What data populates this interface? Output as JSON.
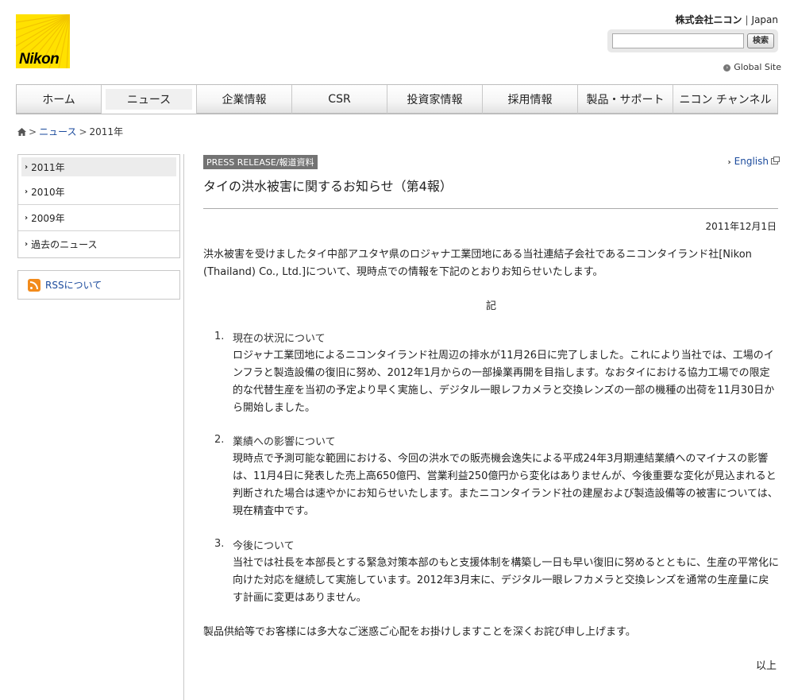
{
  "header": {
    "logo_text": "Nikon",
    "company": "株式会社ニコン",
    "region": "Japan",
    "search": {
      "placeholder": "",
      "button_label": "検索"
    },
    "global_site_label": "Global Site"
  },
  "nav": {
    "items": [
      {
        "label": "ホーム"
      },
      {
        "label": "ニュース"
      },
      {
        "label": "企業情報"
      },
      {
        "label": "CSR"
      },
      {
        "label": "投資家情報"
      },
      {
        "label": "採用情報"
      },
      {
        "label": "製品・サポート"
      },
      {
        "label": "ニコン チャンネル"
      }
    ],
    "active_index": 1
  },
  "breadcrumb": {
    "news": "ニュース",
    "current": "2011年"
  },
  "sidebar": {
    "items": [
      {
        "label": "2011年"
      },
      {
        "label": "2010年"
      },
      {
        "label": "2009年"
      },
      {
        "label": "過去のニュース"
      }
    ],
    "rss_label": "RSSについて"
  },
  "article": {
    "press_label": "PRESS RELEASE/報道資料",
    "english_link": "English",
    "title": "タイの洪水被害に関するお知らせ（第4報）",
    "date": "2011年12月1日",
    "intro": "洪水被害を受けましたタイ中部アユタヤ県のロジャナ工業団地にある当社連結子会社であるニコンタイランド社[Nikon (Thailand) Co., Ltd.]について、現時点での情報を下記のとおりお知らせいたします。",
    "ki": "記",
    "items": [
      {
        "num": "1.",
        "heading": "現在の状況について",
        "text": "ロジャナ工業団地によるニコンタイランド社周辺の排水が11月26日に完了しました。これにより当社では、工場のインフラと製造設備の復旧に努め、2012年1月からの一部操業再開を目指します。なおタイにおける協力工場での限定的な代替生産を当初の予定より早く実施し、デジタル一眼レフカメラと交換レンズの一部の機種の出荷を11月30日から開始しました。"
      },
      {
        "num": "2.",
        "heading": "業績への影響について",
        "text": "現時点で予測可能な範囲における、今回の洪水での販売機会逸失による平成24年3月期連結業績へのマイナスの影響は、11月4日に発表した売上高650億円、営業利益250億円から変化はありませんが、今後重要な変化が見込まれると判断された場合は速やかにお知らせいたします。またニコンタイランド社の建屋および製造設備等の被害については、現在精査中です。"
      },
      {
        "num": "3.",
        "heading": "今後について",
        "text": "当社では社長を本部長とする緊急対策本部のもと支援体制を構築し一日も早い復旧に努めるとともに、生産の平常化に向けた対応を継続して実施しています。2012年3月末に、デジタル一眼レフカメラと交換レンズを通常の生産量に戻す計画に変更はありません。"
      }
    ],
    "closing": "製品供給等でお客様には多大なご迷惑ご心配をお掛けしますことを深くお詫び申し上げます。",
    "ijo": "以上"
  }
}
